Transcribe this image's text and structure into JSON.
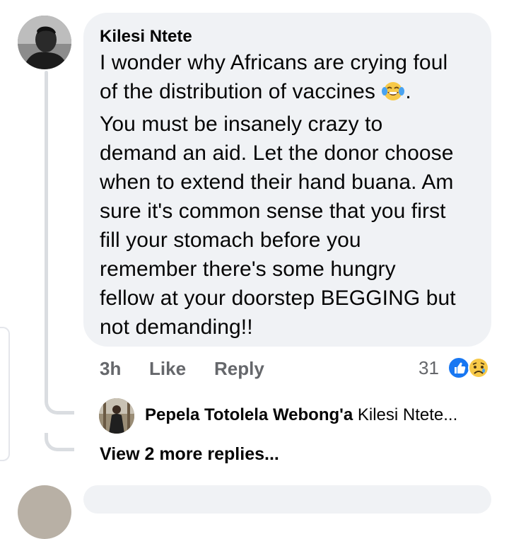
{
  "comment": {
    "author": "Kilesi Ntete",
    "text_part1": "I wonder why Africans are crying foul\nof the distribution of vaccines ",
    "emoji": "tears-of-joy-emoji",
    "text_part2": ".\nYou must be insanely crazy to\ndemand an aid. Let the donor choose\nwhen to extend their hand buana. Am\nsure it's common sense that you first\nfill your stomach before you\nremember there's some hungry\nfellow at your doorstep BEGGING but\nnot demanding!!",
    "time": "3h",
    "like_label": "Like",
    "reply_label": "Reply",
    "reaction_count": "31",
    "reactions": [
      "like-icon",
      "sad-icon"
    ]
  },
  "reply_preview": {
    "author": "Pepela Totolela Webong'a",
    "snippet": "Kilesi Ntete..."
  },
  "view_more_label": "View 2 more replies...",
  "colors": {
    "bubble": "#f0f2f5",
    "meta_text": "#65676b",
    "like_blue": "#1877f2",
    "thread_line": "#dadde1"
  }
}
